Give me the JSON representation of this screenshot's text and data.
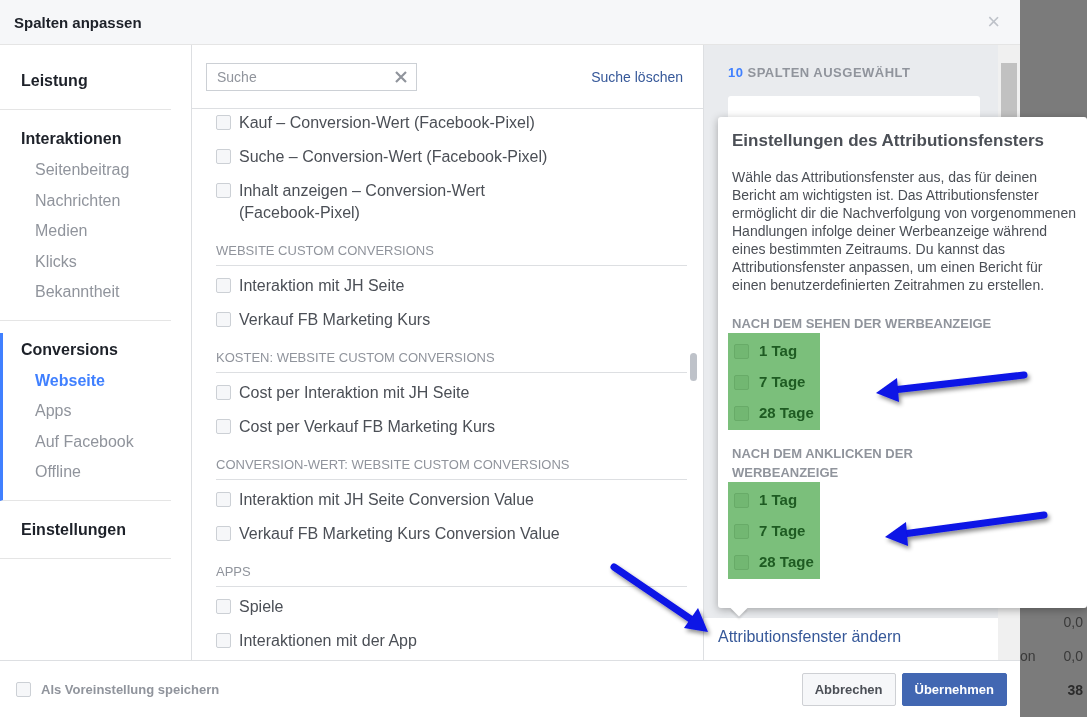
{
  "dialog": {
    "title": "Spalten anpassen",
    "close": "×"
  },
  "nav": [
    {
      "label": "Leistung",
      "selected": false
    },
    {
      "label": "Interaktionen",
      "selected": false,
      "children": [
        {
          "label": "Seitenbeitrag",
          "selected": false
        },
        {
          "label": "Nachrichten",
          "selected": false
        },
        {
          "label": "Medien",
          "selected": false
        },
        {
          "label": "Klicks",
          "selected": false
        },
        {
          "label": "Bekanntheit",
          "selected": false
        }
      ]
    },
    {
      "label": "Conversions",
      "selected": true,
      "children": [
        {
          "label": "Webseite",
          "selected": true
        },
        {
          "label": "Apps",
          "selected": false
        },
        {
          "label": "Auf Facebook",
          "selected": false
        },
        {
          "label": "Offline",
          "selected": false
        }
      ]
    },
    {
      "label": "Einstellungen",
      "selected": false
    }
  ],
  "search": {
    "placeholder": "Suche",
    "clear_link": "Suche löschen"
  },
  "groups": [
    {
      "items": [
        {
          "label": "Kauf – Conversion-Wert (Facebook-Pixel)",
          "checked": false
        },
        {
          "label": "Suche – Conversion-Wert (Facebook-Pixel)",
          "checked": false
        },
        {
          "label": "Inhalt anzeigen – Conversion-Wert (Facebook-Pixel)",
          "checked": false
        }
      ]
    },
    {
      "heading": "WEBSITE CUSTOM CONVERSIONS",
      "items": [
        {
          "label": "Interaktion mit JH Seite",
          "checked": false
        },
        {
          "label": "Verkauf FB Marketing Kurs",
          "checked": false
        }
      ]
    },
    {
      "heading": "KOSTEN: WEBSITE CUSTOM CONVERSIONS",
      "items": [
        {
          "label": "Cost per Interaktion mit JH Seite",
          "checked": false
        },
        {
          "label": "Cost per Verkauf FB Marketing Kurs",
          "checked": false
        }
      ]
    },
    {
      "heading": "CONVERSION-WERT: WEBSITE CUSTOM CONVERSIONS",
      "items": [
        {
          "label": "Interaktion mit JH Seite Conversion Value",
          "checked": false
        },
        {
          "label": "Verkauf FB Marketing Kurs Conversion Value",
          "checked": false
        }
      ]
    },
    {
      "heading": "APPS",
      "items": [
        {
          "label": "Spiele",
          "checked": false
        },
        {
          "label": "Interaktionen mit der App",
          "checked": false
        }
      ]
    }
  ],
  "selected_panel": {
    "count": "10",
    "label": "SPALTEN AUSGEWÄHLT",
    "link": "Attributionsfenster ändern"
  },
  "popover": {
    "title": "Einstellungen des Attributionsfensters",
    "text": "Wähle das Attributionsfenster aus, das für deinen Bericht am wichtigsten ist. Das Attributionsfenster ermöglicht dir die Nachverfolgung von vorgenommenen Handlungen infolge deiner Werbeanzeige während eines bestimmten Zeitraums. Du kannst das Attributionsfenster anpassen, um einen Bericht für einen benutzerdefinierten Zeitrahmen zu erstellen.",
    "sections": [
      {
        "heading": "NACH DEM SEHEN DER WERBEANZEIGE",
        "highlighted": true,
        "options": [
          {
            "label": "1 Tag",
            "checked": false
          },
          {
            "label": "7 Tage",
            "checked": false
          },
          {
            "label": "28 Tage",
            "checked": false
          }
        ]
      },
      {
        "heading": "NACH DEM ANKLICKEN DER WERBEANZEIGE",
        "highlighted": true,
        "options": [
          {
            "label": "1 Tag",
            "checked": false
          },
          {
            "label": "7 Tage",
            "checked": false
          },
          {
            "label": "28 Tage",
            "checked": false
          }
        ]
      }
    ]
  },
  "footer": {
    "save_default": {
      "label": "Als Voreinstellung speichern",
      "checked": false
    },
    "buttons": [
      {
        "label": "Abbrechen",
        "kind": "secondary"
      },
      {
        "label": "Übernehmen",
        "kind": "primary"
      }
    ]
  },
  "backdrop": {
    "rows": [
      {
        "value": "0,0"
      },
      {
        "side": "on",
        "value": "0,0"
      },
      {
        "value": "38"
      }
    ]
  }
}
